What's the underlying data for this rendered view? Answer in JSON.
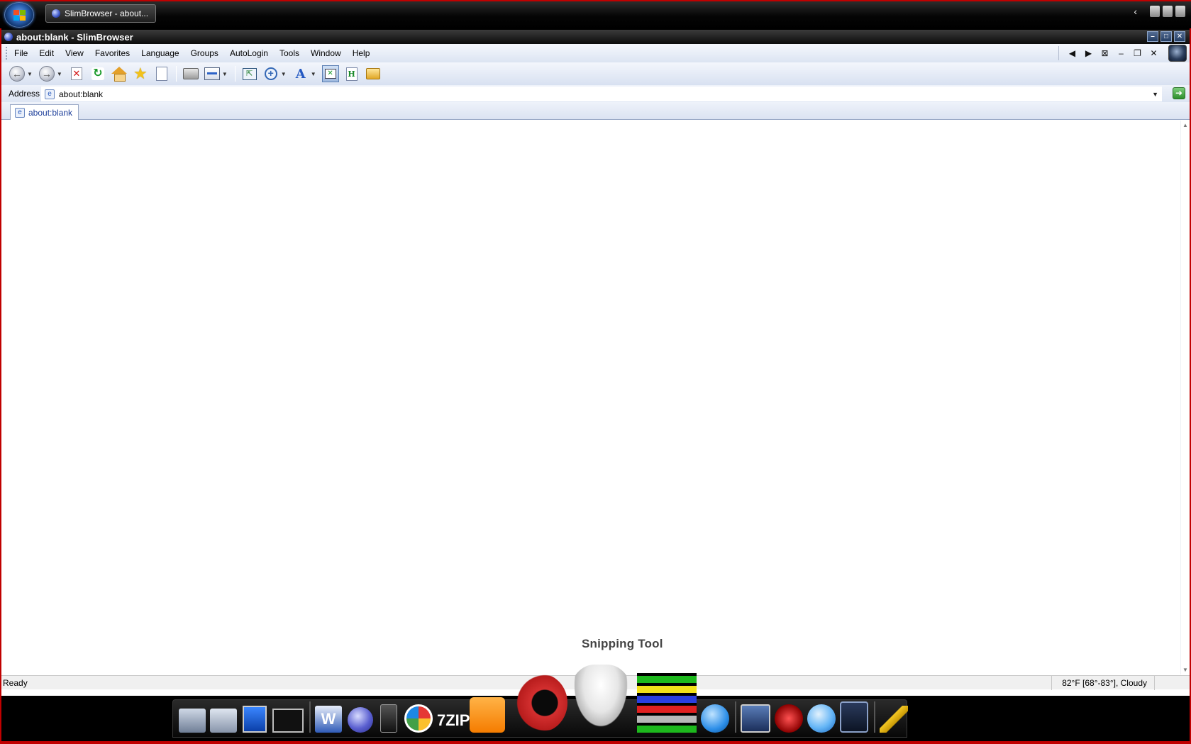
{
  "taskbar": {
    "task_button_label": "SlimBrowser - about...",
    "tray_chevron": "‹"
  },
  "window": {
    "title": "about:blank - SlimBrowser"
  },
  "menu": {
    "items": [
      "File",
      "Edit",
      "View",
      "Favorites",
      "Language",
      "Groups",
      "AutoLogin",
      "Tools",
      "Window",
      "Help"
    ]
  },
  "address": {
    "label": "Address",
    "value": "about:blank"
  },
  "tabs": [
    {
      "label": "about:blank"
    }
  ],
  "status": {
    "text": "Ready",
    "weather": "82°F [68°-83°], Cloudy"
  },
  "dock": {
    "hover_label": "Snipping Tool",
    "icons": [
      "computer-icon",
      "network-icon",
      "desktop-icon",
      "console-icon",
      "word-icon",
      "messenger-icon",
      "ipod-icon",
      "picasa-icon",
      "7zip-icon",
      "settings-icon",
      "ccleaner-icon",
      "snipping-tool-icon",
      "brick-game-icon",
      "sync-icon",
      "slimbrowser-icon",
      "emblem-icon",
      "globe-icon",
      "autobots-icon",
      "tools-icon",
      "recycle-bin-icon",
      "clock-icon"
    ]
  },
  "colors": {
    "frame_red": "#c00000",
    "chrome_blue": "#dce4f2",
    "tab_text": "#1d3f9a"
  }
}
